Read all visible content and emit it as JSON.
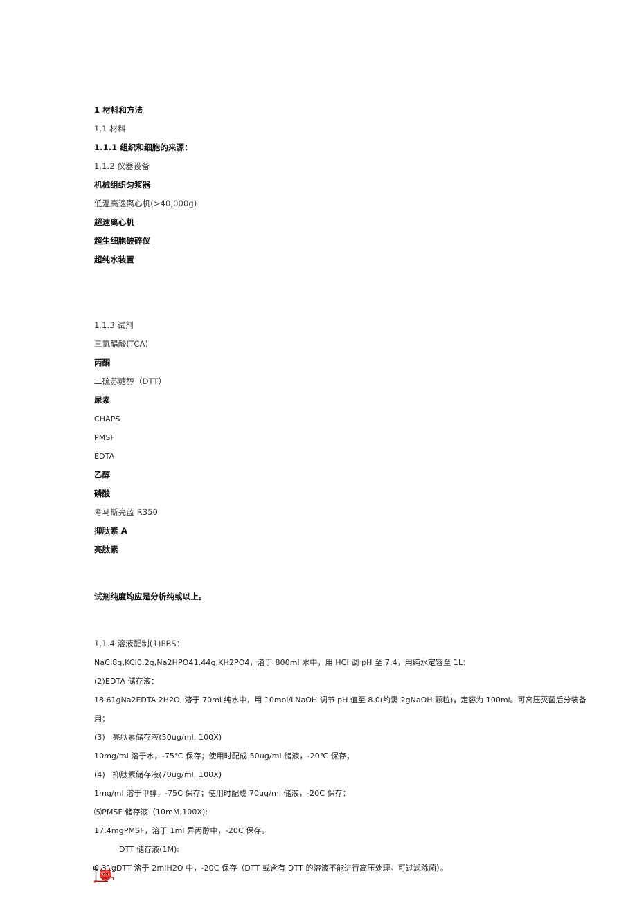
{
  "document": {
    "title": "1 材料和方法",
    "background_color": "#ffffff",
    "text_color": "#1c1c1c",
    "accent_color": "#d42323"
  },
  "sections": {
    "heading_main": "1 材料和方法",
    "heading_11": "1.1 材料",
    "heading_111": "1.1.1 组织和细胞的来源：",
    "heading_112": "1.1.2 仪器设备",
    "equipment": [
      "机械组织匀浆器",
      "低温高速离心机(>40,000g)",
      "超速离心机",
      "超生细胞破碎仪",
      "超纯水装置"
    ],
    "heading_113": "1.1.3 试剂",
    "reagents": [
      "三氯醋酸(TCA)",
      "丙酮",
      "二硫苏糖醇（DTT）",
      "尿素",
      "CHAPS",
      "PMSF",
      "EDTA",
      "乙醇",
      "磷酸",
      "考马斯亮蓝 R350",
      "抑肽素 A",
      "亮肽素"
    ],
    "purity_note": "试剂纯度均应是分析纯或以上。",
    "heading_114": "1.1.4 溶液配制(1)PBS：",
    "solutions": [
      {
        "id": "pbs-recipe",
        "text": "NaCI8g,KCI0.2g,Na2HPO41.44g,KH2PO4，溶于 800ml 水中，用 HCI 调 pH 至 7.4，用纯水定容至 1L："
      },
      {
        "id": "edta-title",
        "text": "(2)EDTA 储存液："
      },
      {
        "id": "edta-recipe",
        "text": "18.61gNa2EDTA·2H2O, 溶于 70ml 纯水中，用 10mol/LNaOH 调节 pH 值至 8.0(约需 2gNaOH 颗粒)，定容为 100ml。可高压灭菌后分装备"
      },
      {
        "id": "edta-recipe-cont",
        "text": "用；"
      },
      {
        "id": "leupeptin-title",
        "text": "(3)   亮肽素储存液(50ug/ml, 100X)"
      },
      {
        "id": "leupeptin-recipe",
        "text": "10mg/ml 溶于水，-75℃ 保存；使用时配成 50ug/ml 储液，-20℃ 保存；"
      },
      {
        "id": "pepstatin-title",
        "text": "(4)   抑肽素储存液(70ug/ml, 100X)"
      },
      {
        "id": "pepstatin-recipe",
        "text": "1mg/ml 溶于甲醇，-75C 保存；使用时配成 70ug/ml 储液，-20C 保存："
      },
      {
        "id": "pmsf-title",
        "text": "⑸PMSF 储存液（10mM,100X):"
      },
      {
        "id": "pmsf-recipe",
        "text": "17.4mgPMSF，溶于 1ml 异丙醇中，-20C 保存。"
      }
    ],
    "dtt_label": "DTT 储存液(1M):",
    "dtt_recipe": "0.31gDTT 溶于 2mlH2O 中，-20C 保存（DTT 或含有 DTT 的溶液不能进行高压处理。可过滤除菌）。"
  },
  "icons": {
    "devil_emoticon": "red-devil-emoticon"
  }
}
